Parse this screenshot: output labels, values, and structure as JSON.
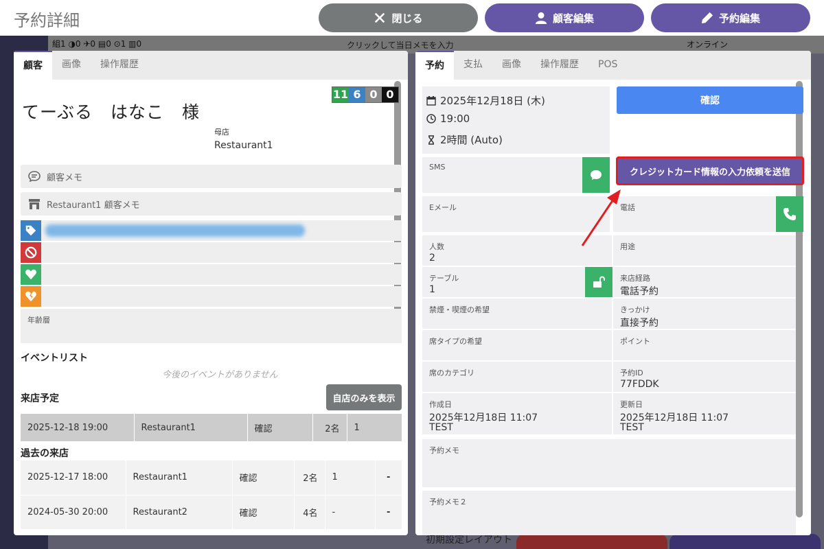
{
  "header": {
    "title": "予約詳細",
    "close_label": "閉じる",
    "edit_customer_label": "顧客編集",
    "edit_reservation_label": "予約編集"
  },
  "background": {
    "stats": "組1 ◑0 ✈0 ▤0 ⊙1 ▥0",
    "memo_placeholder": "クリックして当日メモを入力",
    "online_label": "オンライン",
    "bottom_label": "初期設定レイアウト"
  },
  "left_panel": {
    "tabs": [
      {
        "label": "顧客"
      },
      {
        "label": "画像"
      },
      {
        "label": "操作履歴"
      }
    ],
    "customer_name": "てーぶる　はなこ　様",
    "scores": [
      {
        "value": "11",
        "color": "#2ea44f"
      },
      {
        "value": "6",
        "color": "#3b82c4"
      },
      {
        "value": "0",
        "color": "#8a8a8a"
      },
      {
        "value": "0",
        "color": "#111111"
      }
    ],
    "home_store_label": "母店",
    "home_store_value": "Restaurant1",
    "customer_memo_label": "顧客メモ",
    "store_memo_label": "Restaurant1 顧客メモ",
    "age_label": "年齢層",
    "event_list_title": "イベントリスト",
    "no_events": "今後のイベントがありません",
    "upcoming_title": "来店予定",
    "own_store_only_label": "自店のみを表示",
    "upcoming": [
      {
        "datetime": "2025-12-18 19:00",
        "store": "Restaurant1",
        "status": "確認",
        "people": "2名",
        "table": "1"
      }
    ],
    "past_title": "過去の来店",
    "past": [
      {
        "datetime": "2025-12-17 18:00",
        "store": "Restaurant1",
        "status": "確認",
        "people": "2名",
        "table": "1",
        "extra": "-"
      },
      {
        "datetime": "2024-05-30 20:00",
        "store": "Restaurant2",
        "status": "確認",
        "people": "4名",
        "table": "-",
        "extra": "-"
      }
    ]
  },
  "right_panel": {
    "tabs": [
      {
        "label": "予約"
      },
      {
        "label": "支払"
      },
      {
        "label": "画像"
      },
      {
        "label": "操作履歴"
      },
      {
        "label": "POS"
      }
    ],
    "date": "2025年12月18日 (木)",
    "time": "19:00",
    "duration": "2時間 (Auto)",
    "confirm_label": "確認",
    "sms_label": "SMS",
    "send_card_label": "クレジットカード情報の入力依頼を送信",
    "email_label": "Eメール",
    "phone_label": "電話",
    "people_label": "人数",
    "people_value": "2",
    "purpose_label": "用途",
    "table_label": "テーブル",
    "table_value": "1",
    "route_label": "来店経路",
    "route_value": "電話予約",
    "smoking_label": "禁煙・喫煙の希望",
    "trigger_label": "きっかけ",
    "trigger_value": "直接予約",
    "seat_type_label": "席タイプの希望",
    "point_label": "ポイント",
    "seat_category_label": "席のカテゴリ",
    "reservation_id_label": "予約ID",
    "reservation_id_value": "77FDDK",
    "created_label": "作成日",
    "created_value": "2025年12月18日 11:07",
    "created_by": "TEST",
    "updated_label": "更新日",
    "updated_value": "2025年12月18日 11:07",
    "updated_by": "TEST",
    "memo_label": "予約メモ",
    "memo2_label": "予約メモ２"
  },
  "colors": {
    "accent": "#6556a6",
    "confirm": "#4a87f0",
    "green": "#3ab26a",
    "highlight": "#e02020"
  }
}
